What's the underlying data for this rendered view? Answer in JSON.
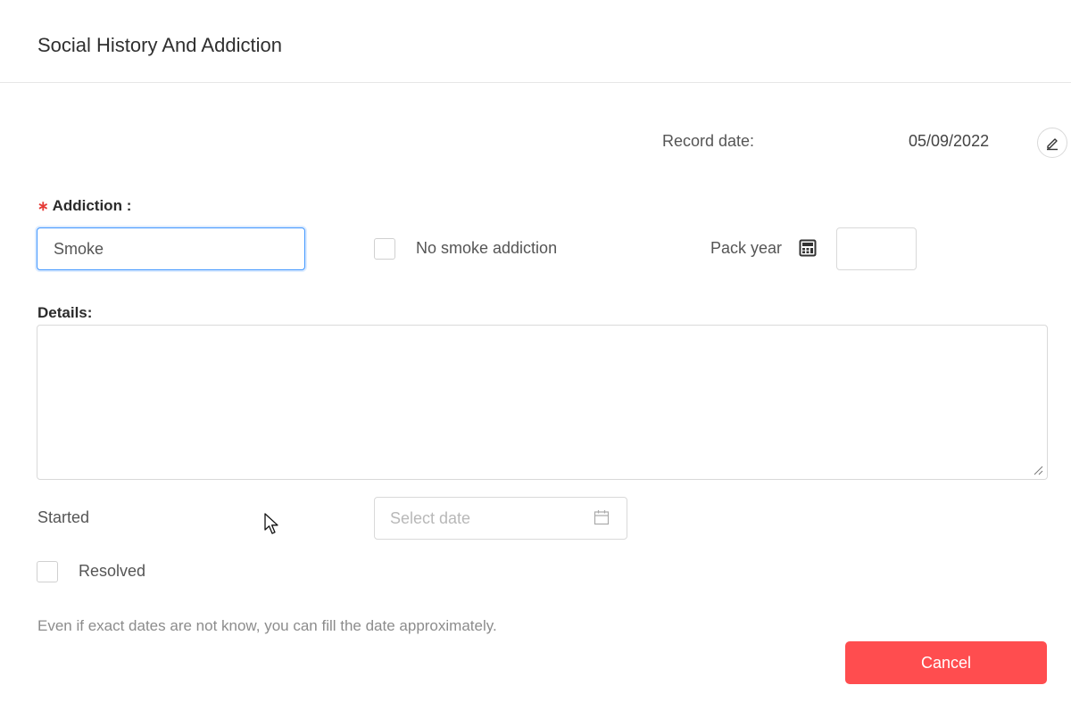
{
  "modal": {
    "title": "Social History And Addiction"
  },
  "record": {
    "label": "Record date:",
    "value": "05/09/2022"
  },
  "addiction": {
    "required_mark": "∗",
    "label": "Addiction",
    "colon": ":",
    "value": "Smoke"
  },
  "no_addiction": {
    "label": "No smoke addiction",
    "checked": false
  },
  "pack_year": {
    "label": "Pack year",
    "value": ""
  },
  "details": {
    "label": "Details",
    "colon": ":",
    "value": ""
  },
  "started": {
    "label": "Started",
    "placeholder": "Select date"
  },
  "resolved": {
    "label": "Resolved",
    "checked": false
  },
  "hint": "Even if exact dates are not know, you can fill the date approximately.",
  "actions": {
    "cancel_label": "Cancel"
  },
  "colors": {
    "danger": "#ff4d4f",
    "focus": "#4096ff",
    "required": "#e53935"
  }
}
